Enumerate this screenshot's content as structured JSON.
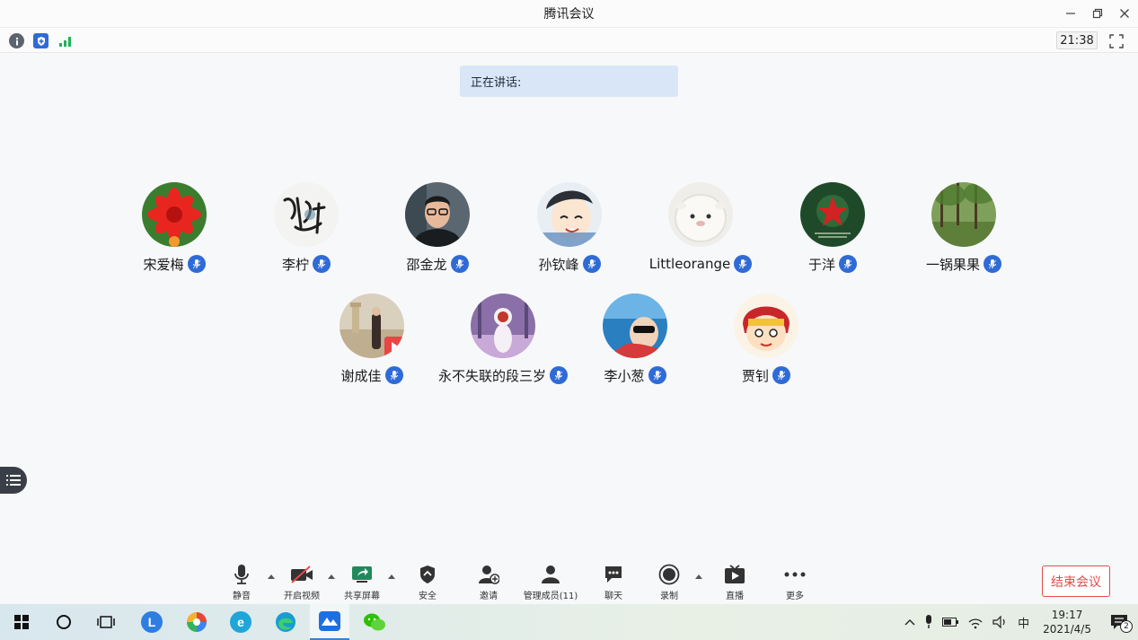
{
  "window": {
    "title": "腾讯会议"
  },
  "info_bar": {
    "timer": "21:38"
  },
  "speaking": {
    "label": "正在讲话:"
  },
  "participants": [
    {
      "name": "宋爱梅"
    },
    {
      "name": "李柠"
    },
    {
      "name": "邵金龙"
    },
    {
      "name": "孙钦峰"
    },
    {
      "name": "Littleorange"
    },
    {
      "name": "于洋"
    },
    {
      "name": "一锅果果"
    },
    {
      "name": "谢成佳"
    },
    {
      "name": "永不失联的段三岁"
    },
    {
      "name": "李小葱"
    },
    {
      "name": "贾钊"
    }
  ],
  "toolbar": {
    "mute": "静音",
    "video": "开启视频",
    "share": "共享屏幕",
    "security": "安全",
    "invite": "邀请",
    "members": "管理成员(11)",
    "chat": "聊天",
    "record": "录制",
    "live": "直播",
    "more": "更多",
    "end": "结束会议"
  },
  "taskbar": {
    "ime": "中",
    "time": "19:17",
    "date": "2021/4/5",
    "notifications": "2"
  },
  "colors": {
    "accent": "#2f6bd6",
    "end_red": "#e34b4b",
    "banner": "#d8e6f7"
  }
}
